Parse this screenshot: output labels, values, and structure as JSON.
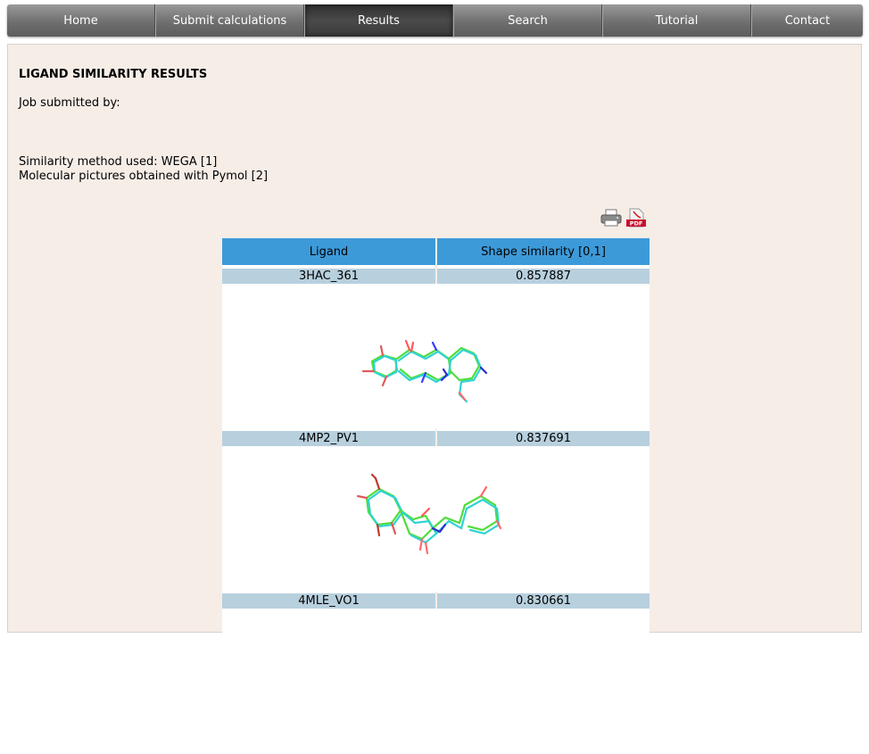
{
  "nav": {
    "items": [
      {
        "label": "Home",
        "active": false
      },
      {
        "label": "Submit calculations",
        "active": false
      },
      {
        "label": "Results",
        "active": true
      },
      {
        "label": "Search",
        "active": false
      },
      {
        "label": "Tutorial",
        "active": false
      },
      {
        "label": "Contact",
        "active": false
      }
    ]
  },
  "page": {
    "title": "LIGAND SIMILARITY RESULTS",
    "job_submitted_by": "Job submitted by:",
    "method_line": "Similarity method used: WEGA [1]",
    "pictures_line": "Molecular pictures obtained with Pymol [2]"
  },
  "icons": {
    "print": "printer-icon",
    "pdf": "pdf-icon",
    "pdf_text": "PDF"
  },
  "table": {
    "headers": [
      "Ligand",
      "Shape similarity [0,1]"
    ],
    "rows": [
      {
        "ligand": "3HAC_361",
        "similarity": "0.857887"
      },
      {
        "ligand": "4MP2_PV1",
        "similarity": "0.837691"
      },
      {
        "ligand": "4MLE_VO1",
        "similarity": "0.830661"
      }
    ]
  }
}
